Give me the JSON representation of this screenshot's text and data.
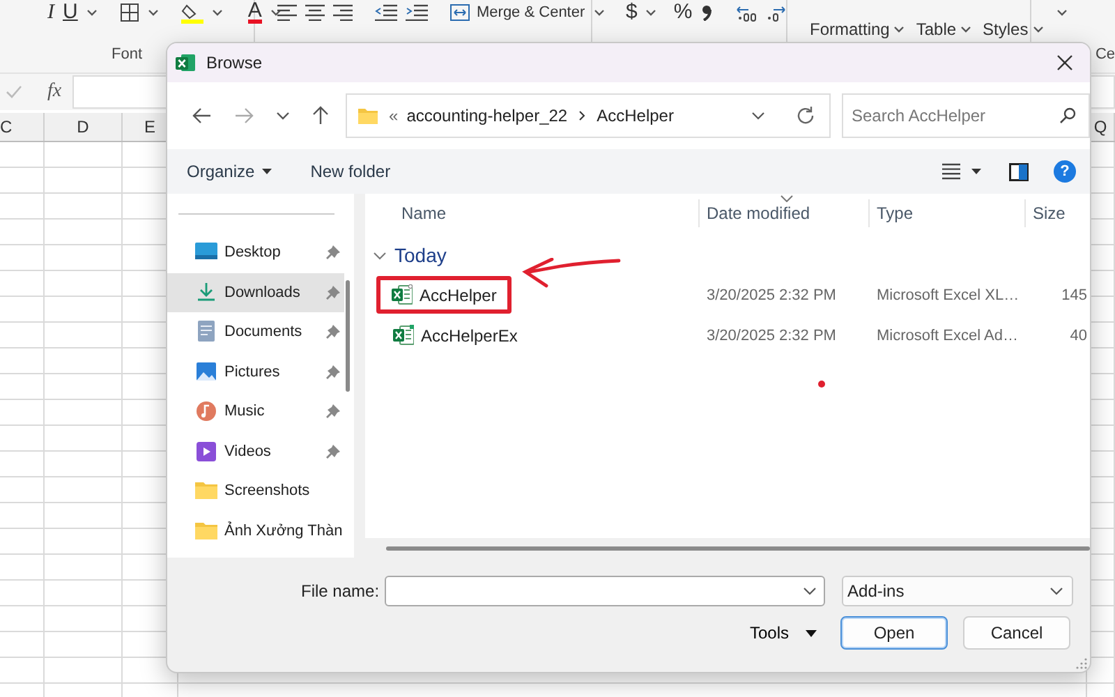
{
  "excel": {
    "ribbon": {
      "format_glyphs": [
        "I",
        "U"
      ],
      "font_color_glyph": "A",
      "font_group": "Font",
      "merge_label": "Merge & Center",
      "currency_glyph": "$",
      "percent_glyph": "%",
      "style_buttons": [
        "Formatting",
        "Table",
        "Styles"
      ],
      "cells_group": "Ce"
    },
    "formula_bar": {
      "fx": "fx"
    },
    "columns": [
      "C",
      "D",
      "E",
      "Q"
    ]
  },
  "dialog": {
    "title": "Browse",
    "path": {
      "overflow": "«",
      "segments": [
        "accounting-helper_22",
        "AccHelper"
      ]
    },
    "search": {
      "placeholder": "Search AccHelper"
    },
    "toolbar": {
      "organize": "Organize",
      "new_folder": "New folder",
      "help": "?"
    },
    "nav_items": [
      {
        "label": "Desktop",
        "kind": "desktop",
        "pinned": true,
        "selected": false
      },
      {
        "label": "Downloads",
        "kind": "downloads",
        "pinned": true,
        "selected": true
      },
      {
        "label": "Documents",
        "kind": "documents",
        "pinned": true,
        "selected": false
      },
      {
        "label": "Pictures",
        "kind": "pictures",
        "pinned": true,
        "selected": false
      },
      {
        "label": "Music",
        "kind": "music",
        "pinned": true,
        "selected": false
      },
      {
        "label": "Videos",
        "kind": "videos",
        "pinned": true,
        "selected": false
      },
      {
        "label": "Screenshots",
        "kind": "folder",
        "pinned": false,
        "selected": false
      },
      {
        "label": "Ảnh Xưởng Thàn",
        "kind": "folder",
        "pinned": false,
        "selected": false
      }
    ],
    "columns": [
      "Name",
      "Date modified",
      "Type",
      "Size"
    ],
    "group": {
      "label": "Today",
      "expanded": true
    },
    "files": [
      {
        "name": "AccHelper",
        "kind": "workbook",
        "date": "3/20/2025 2:32 PM",
        "type": "Microsoft Excel XL…",
        "size": "145",
        "highlighted": true
      },
      {
        "name": "AccHelperEx",
        "kind": "addin",
        "date": "3/20/2025 2:32 PM",
        "type": "Microsoft Excel Ad…",
        "size": "40",
        "highlighted": false
      }
    ],
    "file_name_label": "File name:",
    "filter": "Add-ins",
    "tools": "Tools",
    "buttons": [
      {
        "label": "Open",
        "default": true
      },
      {
        "label": "Cancel",
        "default": false
      }
    ]
  }
}
